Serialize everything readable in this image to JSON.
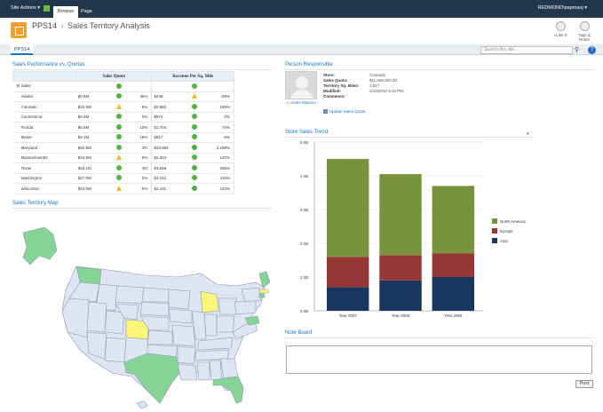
{
  "ribbon": {
    "site_actions": "Site Actions ▾",
    "tabs": [
      "Browse",
      "Page"
    ],
    "user": "REDMOND\\papmanj ▾"
  },
  "header": {
    "site": "PPS14",
    "separator": "›",
    "page_title": "Sales Territory Analysis",
    "like_label": "I Like It",
    "tags_label": "Tags & Notes"
  },
  "topnav": {
    "tab": "PPS14"
  },
  "search": {
    "placeholder": "Search this site..."
  },
  "scorecard": {
    "title": "Sales Performance vs. Quotas",
    "headers": [
      "Sales Quota",
      "Revenue Per Sq. Mile"
    ],
    "root_label": "Sales",
    "rows": [
      {
        "label": "Alaska",
        "v1": "$0.6M",
        "i1": "good",
        "p1": "36%",
        "v2": "$446",
        "i2": "warn",
        "p2": "-50%"
      },
      {
        "label": "Colorado",
        "v1": "$10.9M",
        "i1": "warn",
        "p1": "-6%",
        "v2": "$2,882",
        "i2": "good",
        "p2": "185%"
      },
      {
        "label": "Connecticut",
        "v1": "$4.4M",
        "i1": "good",
        "p1": "0%",
        "v2": "$974",
        "i2": "good",
        "p2": "-2%"
      },
      {
        "label": "Florida",
        "v1": "$6.5M",
        "i1": "good",
        "p1": "10%",
        "v2": "$1,704",
        "i2": "good",
        "p2": "70%"
      },
      {
        "label": "Maine",
        "v1": "$3.1M",
        "i1": "good",
        "p1": "18%",
        "v2": "$917",
        "i2": "good",
        "p2": "-8%"
      },
      {
        "label": "Maryland",
        "v1": "$62.8M",
        "i1": "good",
        "p1": "3%",
        "v2": "$33,984",
        "i2": "good",
        "p2": "3,298%"
      },
      {
        "label": "Massachusetts",
        "v1": "$10.9M",
        "i1": "warn",
        "p1": "-5%",
        "v2": "$2,204",
        "i2": "good",
        "p2": "120%"
      },
      {
        "label": "Texas",
        "v1": "$18.1M",
        "i1": "good",
        "p1": "3%",
        "v2": "$3,656",
        "i2": "good",
        "p2": "266%"
      },
      {
        "label": "Washington",
        "v1": "$27.0M",
        "i1": "good",
        "p1": "2%",
        "v2": "$4,152",
        "i2": "good",
        "p2": "315%"
      },
      {
        "label": "Wisconsin",
        "v1": "$10.9M",
        "i1": "warn",
        "p1": "-5%",
        "v2": "$2,431",
        "i2": "good",
        "p2": "143%"
      }
    ]
  },
  "map": {
    "title": "Sales Territory Map",
    "colors": {
      "base": "#dfe5f1",
      "green": "#86d597",
      "yellow": "#fbf879",
      "border": "#8a96b4"
    }
  },
  "person": {
    "title": "Person Responsible",
    "name": "Andre Malcom",
    "fields": [
      {
        "k": "Store:",
        "v": "Colorado"
      },
      {
        "k": "Sales Quota:",
        "v": "$11,600,000.00"
      },
      {
        "k": "Territory Sq. Miles:",
        "v": "3,817"
      },
      {
        "k": "Modified:",
        "v": "2/10/2010 5:04 PM"
      },
      {
        "k": "Comments:",
        "v": ""
      }
    ],
    "update_link": "Update Sales Quota"
  },
  "trend": {
    "title": "Store Sales Trend",
    "chevron": "▾"
  },
  "chart_data": {
    "type": "bar",
    "stacked": true,
    "categories": [
      "Year 2007",
      "Year 2008",
      "Year 2009"
    ],
    "series": [
      {
        "name": "Asia",
        "color": "#17375e",
        "values": [
          0.7,
          0.9,
          1.0
        ]
      },
      {
        "name": "Europe",
        "color": "#953735",
        "values": [
          0.9,
          0.75,
          0.7
        ]
      },
      {
        "name": "North America",
        "color": "#77933c",
        "values": [
          2.9,
          2.4,
          2.0
        ]
      }
    ],
    "yticks": [
      "0.0B",
      "1.0B",
      "2.0B",
      "3.0B",
      "4.0B",
      "5.0B"
    ],
    "ylim": [
      0,
      5
    ],
    "legend_position": "right",
    "grid": true
  },
  "noteboard": {
    "title": "Note Board",
    "post_label": "Post"
  }
}
